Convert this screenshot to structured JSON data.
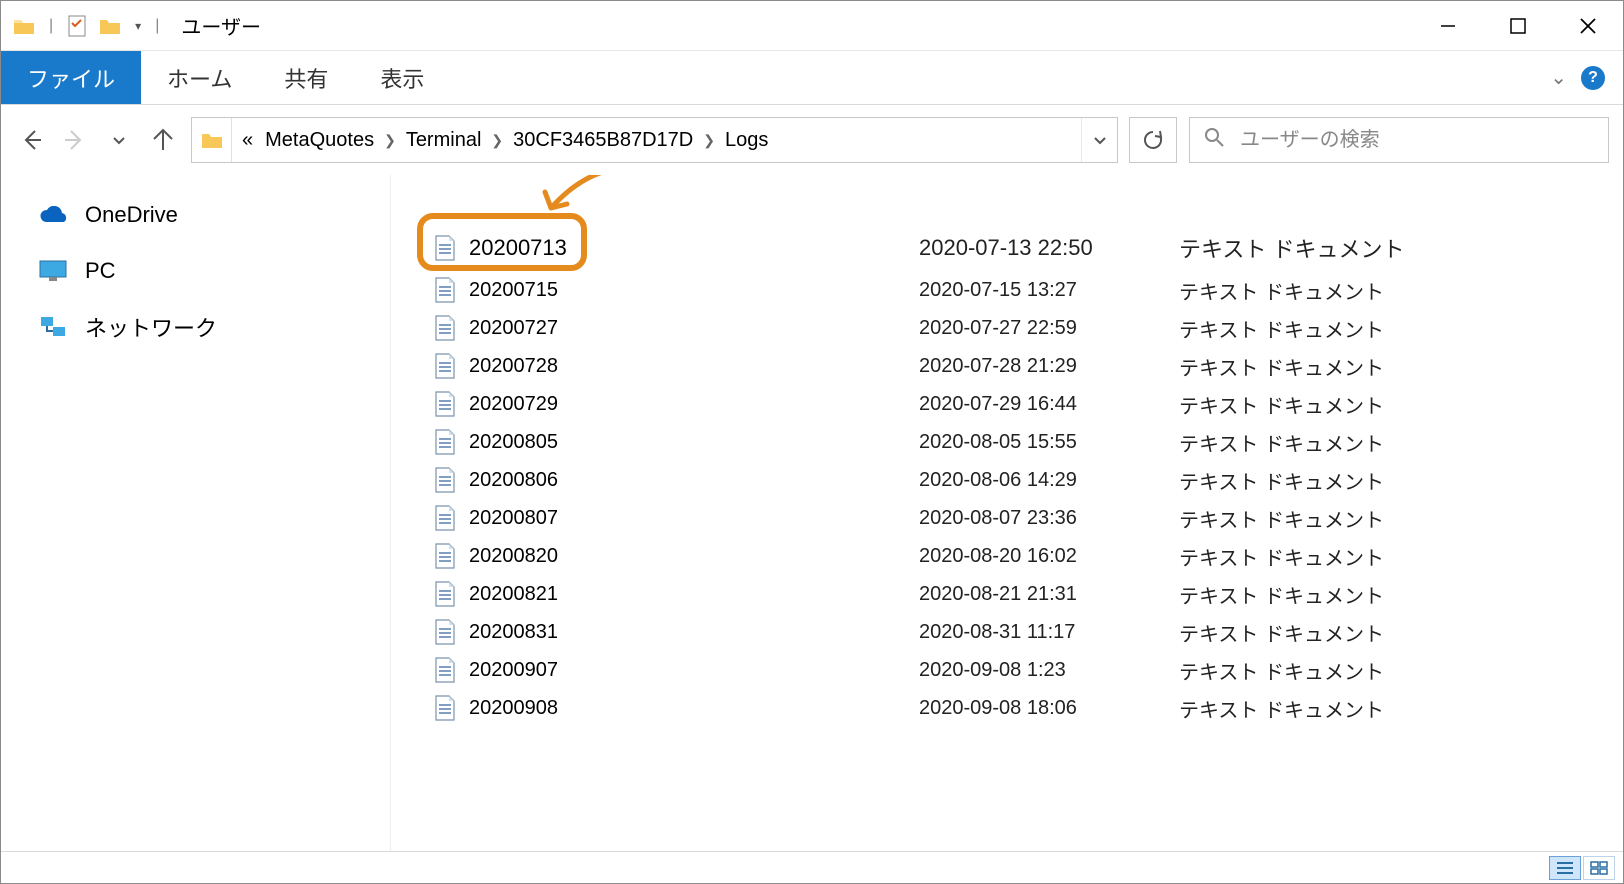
{
  "window": {
    "title": "ユーザー"
  },
  "ribbon": {
    "file": "ファイル",
    "tabs": [
      "ホーム",
      "共有",
      "表示"
    ]
  },
  "breadcrumb": {
    "lead": "«",
    "items": [
      "MetaQuotes",
      "Terminal",
      "30CF3465B87D17D",
      "Logs"
    ]
  },
  "search": {
    "placeholder": "ユーザーの検索"
  },
  "sidebar": {
    "items": [
      {
        "label": "OneDrive",
        "icon": "onedrive"
      },
      {
        "label": "PC",
        "icon": "pc"
      },
      {
        "label": "ネットワーク",
        "icon": "network"
      }
    ]
  },
  "files": [
    {
      "name": "20200713",
      "date": "2020-07-13 22:50",
      "type": "テキスト ドキュメント",
      "highlighted": true
    },
    {
      "name": "20200715",
      "date": "2020-07-15 13:27",
      "type": "テキスト ドキュメント"
    },
    {
      "name": "20200727",
      "date": "2020-07-27 22:59",
      "type": "テキスト ドキュメント"
    },
    {
      "name": "20200728",
      "date": "2020-07-28 21:29",
      "type": "テキスト ドキュメント"
    },
    {
      "name": "20200729",
      "date": "2020-07-29 16:44",
      "type": "テキスト ドキュメント"
    },
    {
      "name": "20200805",
      "date": "2020-08-05 15:55",
      "type": "テキスト ドキュメント"
    },
    {
      "name": "20200806",
      "date": "2020-08-06 14:29",
      "type": "テキスト ドキュメント"
    },
    {
      "name": "20200807",
      "date": "2020-08-07 23:36",
      "type": "テキスト ドキュメント"
    },
    {
      "name": "20200820",
      "date": "2020-08-20 16:02",
      "type": "テキスト ドキュメント"
    },
    {
      "name": "20200821",
      "date": "2020-08-21 21:31",
      "type": "テキスト ドキュメント"
    },
    {
      "name": "20200831",
      "date": "2020-08-31 11:17",
      "type": "テキスト ドキュメント"
    },
    {
      "name": "20200907",
      "date": "2020-09-08 1:23",
      "type": "テキスト ドキュメント"
    },
    {
      "name": "20200908",
      "date": "2020-09-08 18:06",
      "type": "テキスト ドキュメント"
    }
  ]
}
